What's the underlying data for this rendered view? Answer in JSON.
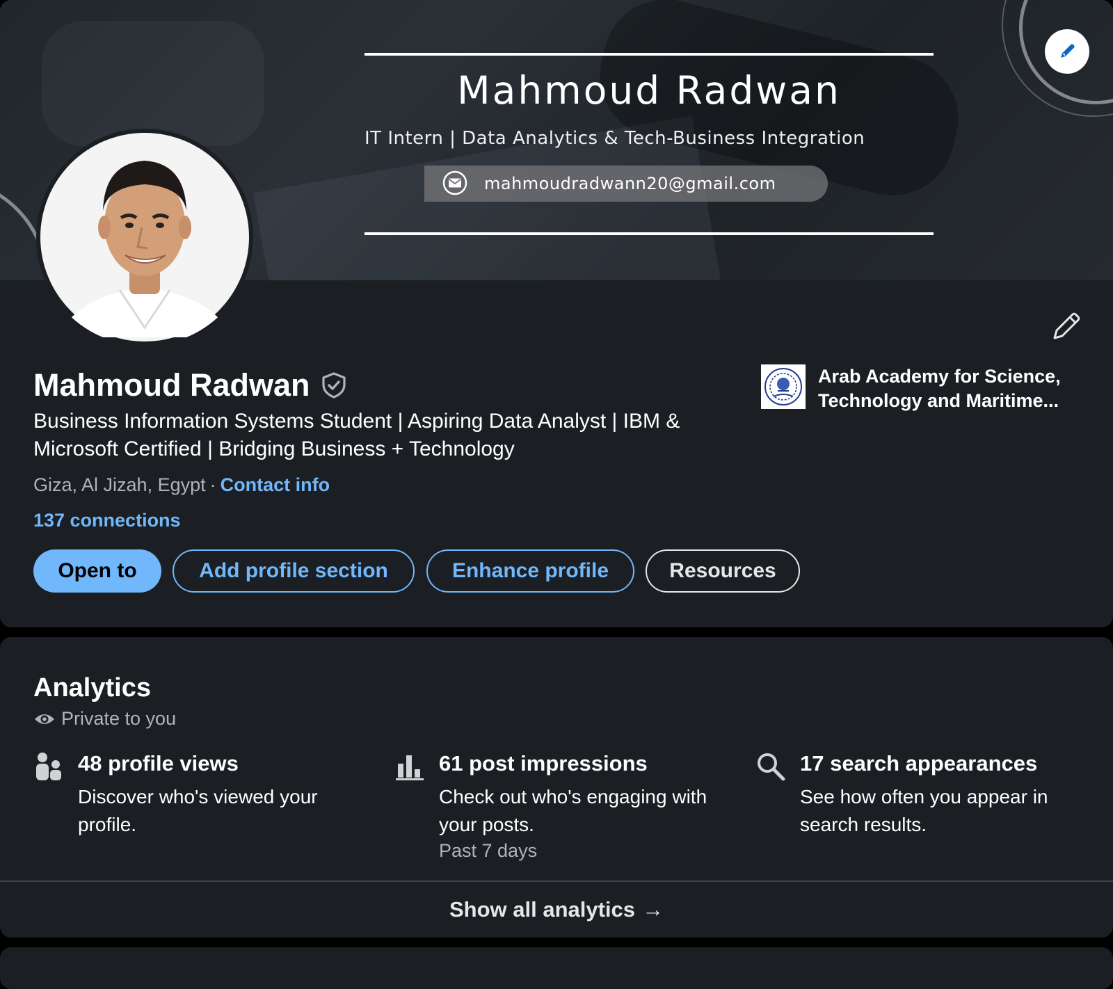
{
  "banner": {
    "name": "Mahmoud Radwan",
    "tagline": "IT Intern | Data Analytics & Tech-Business Integration",
    "email": "mahmoudradwann20@gmail.com",
    "edit_icon": "pencil-icon"
  },
  "profile": {
    "name": "Mahmoud Radwan",
    "verified_icon": "shield-check-icon",
    "headline": "Business Information Systems Student | Aspiring Data Analyst | IBM & Microsoft Certified | Bridging Business + Technology",
    "location": "Giza, Al Jizah, Egypt",
    "separator": "·",
    "contact_info": "Contact info",
    "connections": "137 connections",
    "school": "Arab Academy for Science, Technology and Maritime..."
  },
  "buttons": {
    "open_to": "Open to",
    "add_section": "Add profile section",
    "enhance": "Enhance profile",
    "resources": "Resources"
  },
  "analytics": {
    "title": "Analytics",
    "private": "Private to you",
    "metrics": [
      {
        "icon": "people-icon",
        "title": "48 profile views",
        "desc": "Discover who's viewed your profile.",
        "period": ""
      },
      {
        "icon": "bar-chart-icon",
        "title": "61 post impressions",
        "desc": "Check out who's engaging with your posts.",
        "period": "Past 7 days"
      },
      {
        "icon": "search-icon",
        "title": "17 search appearances",
        "desc": "See how often you appear in search results.",
        "period": ""
      }
    ],
    "show_all": "Show all analytics",
    "arrow": "→"
  },
  "colors": {
    "accent": "#71b7fb",
    "card": "#1b1f23",
    "background": "#000000",
    "secondary_text": "#b0b3b8"
  }
}
